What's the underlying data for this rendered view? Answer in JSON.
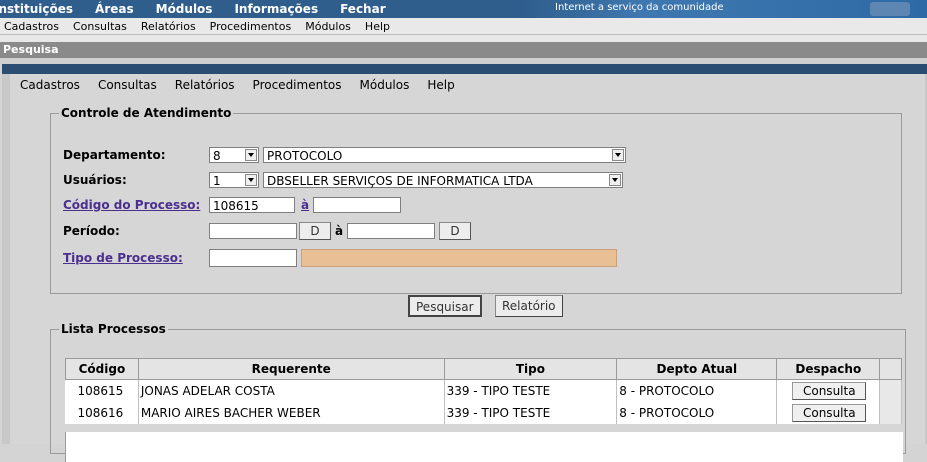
{
  "top_menu": [
    "Instituições",
    "Áreas",
    "Módulos",
    "Informações",
    "Fechar"
  ],
  "tagline": "Internet a serviço da comunidade",
  "sub_menu": [
    "Cadastros",
    "Consultas",
    "Relatórios",
    "Procedimentos",
    "Módulos",
    "Help"
  ],
  "pesquisa_bar": "Pesquisa",
  "inner_menu": [
    "Cadastros",
    "Consultas",
    "Relatórios",
    "Procedimentos",
    "Módulos",
    "Help"
  ],
  "form": {
    "legend": "Controle de Atendimento",
    "departamento_label": "Departamento:",
    "departamento_code": "8",
    "departamento_name": "PROTOCOLO",
    "usuarios_label": "Usuários:",
    "usuario_code": "1",
    "usuario_name": "DBSELLER SERVIÇOS DE INFORMATICA LTDA",
    "codigo_label": "Código do Processo:",
    "codigo_value": "108615",
    "a_link": "à",
    "codigo_to": "",
    "periodo_label": "Período:",
    "periodo_from": "",
    "d_button": "D",
    "a_text": "à",
    "periodo_to": "",
    "tipo_label": "Tipo de Processo:",
    "tipo_value": ""
  },
  "buttons": {
    "pesquisar": "Pesquisar",
    "relatorio": "Relatório"
  },
  "list": {
    "legend": "Lista Processos",
    "columns": [
      "Código",
      "Requerente",
      "Tipo",
      "Depto Atual",
      "Despacho"
    ],
    "rows": [
      {
        "codigo": "108615",
        "requerente": "JONAS ADELAR COSTA",
        "tipo": "339 - TIPO TESTE",
        "depto": "8 - PROTOCOLO",
        "despacho": "Consulta"
      },
      {
        "codigo": "108616",
        "requerente": "MARIO AIRES BACHER WEBER",
        "tipo": "339 - TIPO TESTE",
        "depto": "8 - PROTOCOLO",
        "despacho": "Consulta"
      }
    ]
  },
  "colors": {
    "top_bar": "#2f5d8c",
    "pesquisa_bar": "#8a8a8a",
    "tipo_fill": "#e9c095",
    "link": "#4b2f8f"
  }
}
